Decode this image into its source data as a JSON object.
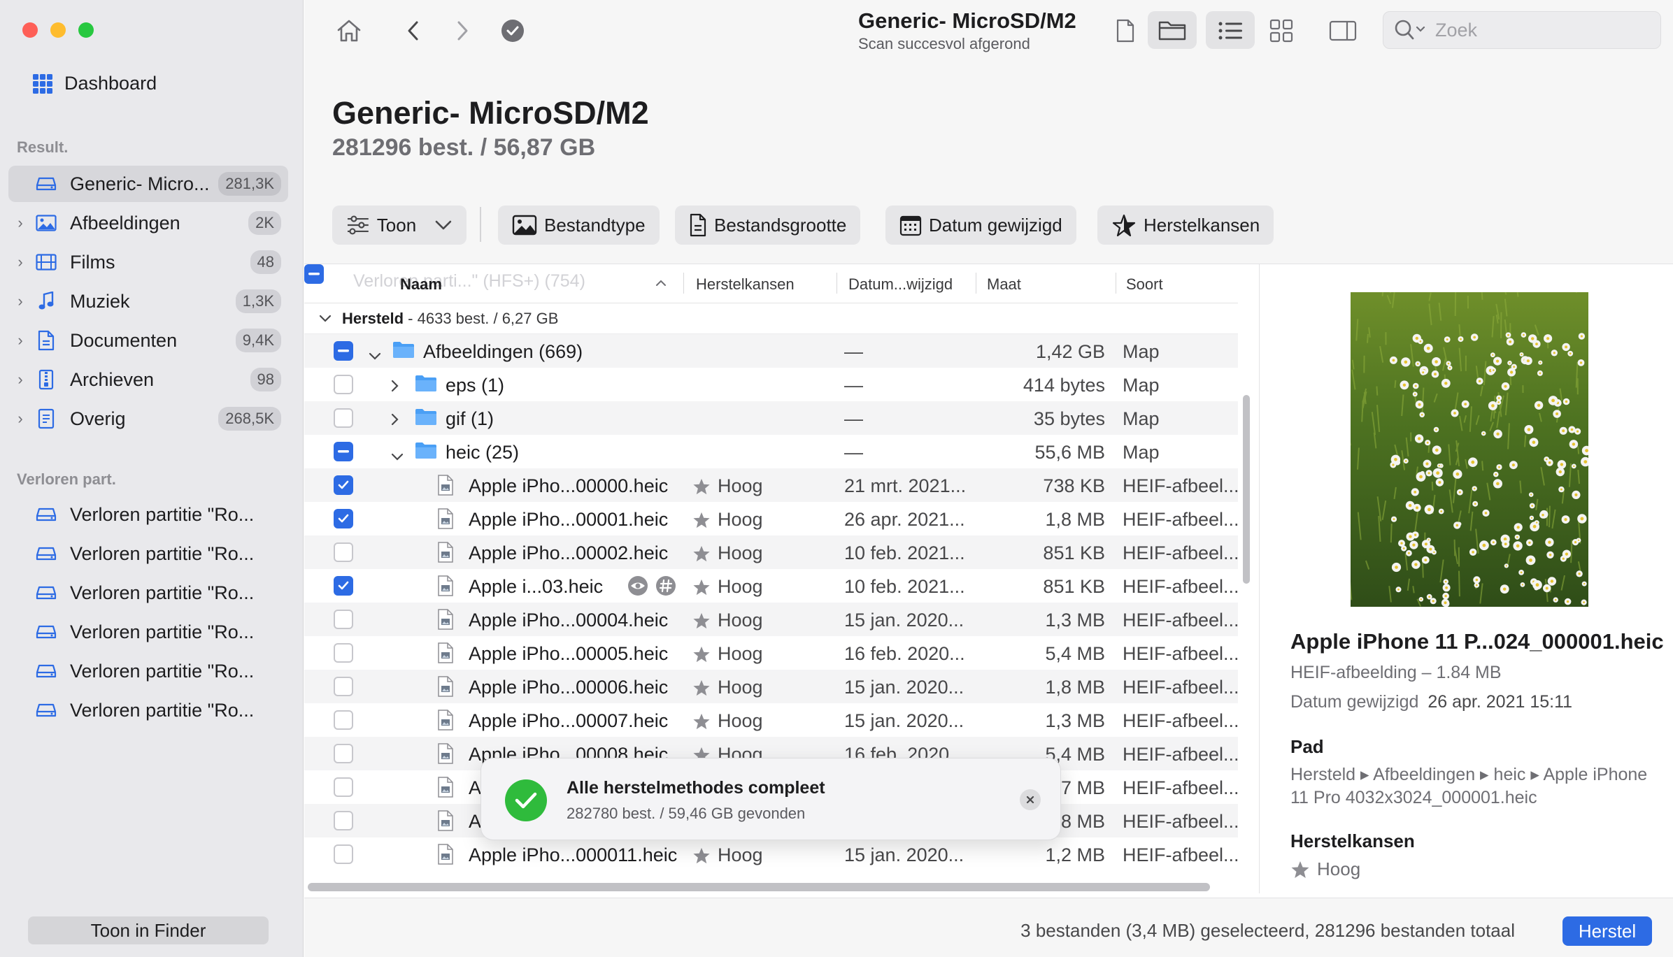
{
  "toolbar": {
    "title": "Generic- MicroSD/M2",
    "subtitle": "Scan succesvol afgerond",
    "search_placeholder": "Zoek"
  },
  "sidebar": {
    "dashboard_label": "Dashboard",
    "results_heading": "Result.",
    "results": [
      {
        "label": "Generic- Micro...",
        "count": "281,3K",
        "icon": "drive-icon",
        "active": true
      },
      {
        "label": "Afbeeldingen",
        "count": "2K",
        "icon": "image-icon"
      },
      {
        "label": "Films",
        "count": "48",
        "icon": "film-icon"
      },
      {
        "label": "Muziek",
        "count": "1,3K",
        "icon": "music-note-icon"
      },
      {
        "label": "Documenten",
        "count": "9,4K",
        "icon": "document-icon"
      },
      {
        "label": "Archieven",
        "count": "98",
        "icon": "archive-icon"
      },
      {
        "label": "Overig",
        "count": "268,5K",
        "icon": "other-file-icon"
      }
    ],
    "lost_heading": "Verloren part.",
    "lost": [
      {
        "label": "Verloren partitie \"Ro..."
      },
      {
        "label": "Verloren partitie \"Ro..."
      },
      {
        "label": "Verloren partitie \"Ro..."
      },
      {
        "label": "Verloren partitie \"Ro..."
      },
      {
        "label": "Verloren partitie \"Ro..."
      },
      {
        "label": "Verloren partitie \"Ro..."
      }
    ],
    "finder_button": "Toon in Finder"
  },
  "header": {
    "title": "Generic- MicroSD/M2",
    "summary": "281296 best. / 56,87 GB"
  },
  "filters": {
    "show": "Toon",
    "filetype": "Bestandtype",
    "filesize": "Bestandsgrootte",
    "date_modified": "Datum gewijzigd",
    "recovery_chances": "Herstelkansen"
  },
  "table": {
    "columns": {
      "name": "Naam",
      "chances": "Herstelkansen",
      "date": "Datum...wijzigd",
      "size": "Maat",
      "kind": "Soort"
    },
    "ghost_text": "Verloren parti...\" (HFS+) (754)",
    "group": {
      "label": "Hersteld",
      "summary": "- 4633 best. / 6,27 GB"
    },
    "rows": [
      {
        "state": "mixed",
        "level": 0,
        "expand": "down",
        "type": "folder",
        "name": "Afbeeldingen (669)",
        "rank": "",
        "date": "—",
        "size": "1,42 GB",
        "kind": "Map"
      },
      {
        "state": "none",
        "level": 1,
        "expand": "right",
        "type": "folder",
        "name": "eps (1)",
        "rank": "",
        "date": "—",
        "size": "414 bytes",
        "kind": "Map"
      },
      {
        "state": "none",
        "level": 1,
        "expand": "right",
        "type": "folder",
        "name": "gif (1)",
        "rank": "",
        "date": "—",
        "size": "35 bytes",
        "kind": "Map"
      },
      {
        "state": "mixed",
        "level": 1,
        "expand": "down",
        "type": "folder",
        "name": "heic (25)",
        "rank": "",
        "date": "—",
        "size": "55,6 MB",
        "kind": "Map"
      },
      {
        "state": "checked",
        "level": 2,
        "expand": "",
        "type": "file",
        "name": "Apple iPho...00000.heic",
        "rank": "Hoog",
        "date": "21 mrt. 2021...",
        "size": "738 KB",
        "kind": "HEIF-afbeel..."
      },
      {
        "state": "checked",
        "level": 2,
        "expand": "",
        "type": "file",
        "name": "Apple iPho...00001.heic",
        "rank": "Hoog",
        "date": "26 apr. 2021...",
        "size": "1,8 MB",
        "kind": "HEIF-afbeel..."
      },
      {
        "state": "none",
        "level": 2,
        "expand": "",
        "type": "file",
        "name": "Apple iPho...00002.heic",
        "rank": "Hoog",
        "date": "10 feb. 2021...",
        "size": "851 KB",
        "kind": "HEIF-afbeel..."
      },
      {
        "state": "checked",
        "level": 2,
        "expand": "",
        "type": "file",
        "name": "Apple i...03.heic",
        "rank": "Hoog",
        "date": "10 feb. 2021...",
        "size": "851 KB",
        "kind": "HEIF-afbeel...",
        "actions": true
      },
      {
        "state": "none",
        "level": 2,
        "expand": "",
        "type": "file",
        "name": "Apple iPho...00004.heic",
        "rank": "Hoog",
        "date": "15 jan. 2020...",
        "size": "1,3 MB",
        "kind": "HEIF-afbeel..."
      },
      {
        "state": "none",
        "level": 2,
        "expand": "",
        "type": "file",
        "name": "Apple iPho...00005.heic",
        "rank": "Hoog",
        "date": "16 feb. 2020...",
        "size": "5,4 MB",
        "kind": "HEIF-afbeel..."
      },
      {
        "state": "none",
        "level": 2,
        "expand": "",
        "type": "file",
        "name": "Apple iPho...00006.heic",
        "rank": "Hoog",
        "date": "15 jan. 2020...",
        "size": "1,8 MB",
        "kind": "HEIF-afbeel..."
      },
      {
        "state": "none",
        "level": 2,
        "expand": "",
        "type": "file",
        "name": "Apple iPho...00007.heic",
        "rank": "Hoog",
        "date": "15 jan. 2020...",
        "size": "1,3 MB",
        "kind": "HEIF-afbeel..."
      },
      {
        "state": "none",
        "level": 2,
        "expand": "",
        "type": "file",
        "name": "Apple iPho...00008.heic",
        "rank": "Hoog",
        "date": "16 feb. 2020...",
        "size": "5,4 MB",
        "kind": "HEIF-afbeel..."
      },
      {
        "state": "none",
        "level": 2,
        "expand": "",
        "type": "file",
        "name": "A",
        "rank": "",
        "date": "",
        "size": ",7 MB",
        "kind": "HEIF-afbeel..."
      },
      {
        "state": "none",
        "level": 2,
        "expand": "",
        "type": "file",
        "name": "A",
        "rank": "",
        "date": "",
        "size": ",8 MB",
        "kind": "HEIF-afbeel..."
      },
      {
        "state": "none",
        "level": 2,
        "expand": "",
        "type": "file",
        "name": "Apple iPho...000011.heic",
        "rank": "Hoog",
        "date": "15 jan. 2020...",
        "size": "1,2 MB",
        "kind": "HEIF-afbeel..."
      }
    ]
  },
  "toast": {
    "title": "Alle herstelmethodes compleet",
    "subtitle": "282780 best. / 59,46 GB gevonden"
  },
  "preview": {
    "name": "Apple iPhone 11 P...024_000001.heic",
    "type_size": "HEIF-afbeelding – 1.84 MB",
    "date_label": "Datum gewijzigd",
    "date_value": "26 apr. 2021 15:11",
    "path_heading": "Pad",
    "path": "Hersteld ▸ Afbeeldingen ▸ heic ▸ Apple iPhone 11 Pro 4032x3024_000001.heic",
    "chances_heading": "Herstelkansen",
    "chances_value": "Hoog"
  },
  "footer": {
    "status": "3 bestanden (3,4 MB) geselecteerd, 281296 bestanden totaal",
    "recover_button": "Herstel"
  },
  "colors": {
    "accent": "#2d6be4",
    "success": "#2fbb3c",
    "folder": "#4a9ff5"
  }
}
